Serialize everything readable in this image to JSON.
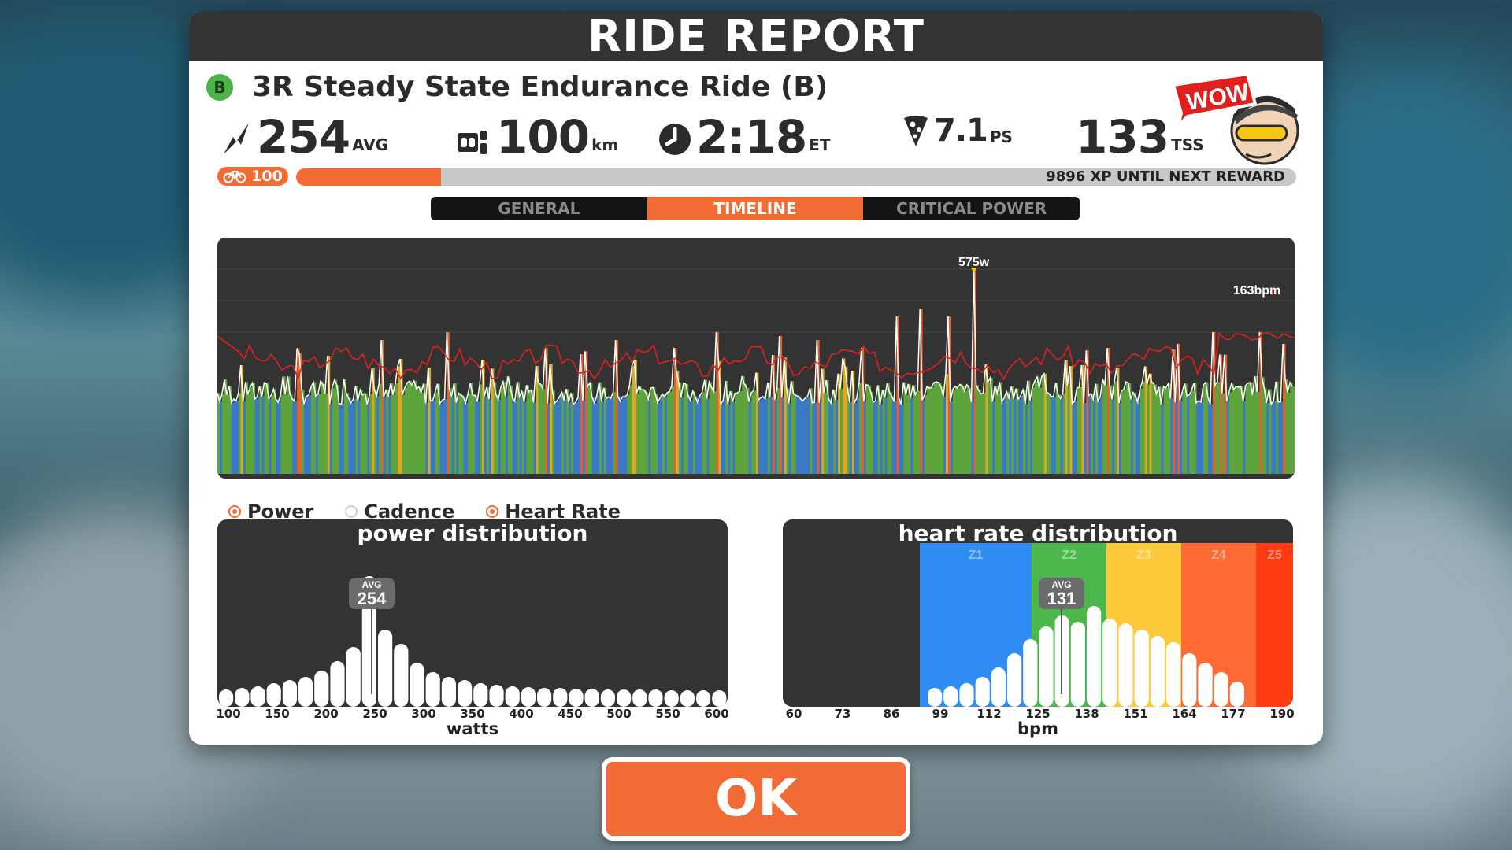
{
  "header": {
    "title": "RIDE REPORT"
  },
  "ride": {
    "category": "B",
    "title": "3R Steady State Endurance Ride (B)"
  },
  "stats": [
    {
      "name": "power",
      "value": "254",
      "unit": "AVG"
    },
    {
      "name": "distance",
      "value": "100",
      "unit": "km"
    },
    {
      "name": "time",
      "value": "2:18",
      "unit": "ET"
    },
    {
      "name": "pizza",
      "value": "7.1",
      "unit": "PS"
    },
    {
      "name": "tss",
      "value": "133",
      "unit": "TSS"
    }
  ],
  "badge": {
    "text": "WOW!"
  },
  "progress": {
    "level": "100",
    "xp_text": "9896 XP UNTIL NEXT REWARD",
    "fill_fraction": 0.145
  },
  "tabs": [
    {
      "label": "GENERAL",
      "active": false
    },
    {
      "label": "TIMELINE",
      "active": true
    },
    {
      "label": "CRITICAL POWER",
      "active": false
    }
  ],
  "timeline": {
    "peak_power_label": "575w",
    "peak_hr_label": "163bpm"
  },
  "legend": [
    {
      "label": "Power",
      "selected": true
    },
    {
      "label": "Cadence",
      "selected": false
    },
    {
      "label": "Heart Rate",
      "selected": true
    }
  ],
  "power_dist": {
    "title": "power distribution",
    "avg_label": "AVG",
    "avg_value": "254",
    "xlabel": "watts",
    "ticks": [
      "100",
      "150",
      "200",
      "250",
      "300",
      "350",
      "400",
      "450",
      "500",
      "550",
      "600"
    ]
  },
  "hr_dist": {
    "title": "heart rate distribution",
    "avg_label": "AVG",
    "avg_value": "131",
    "xlabel": "bpm",
    "ticks": [
      "60",
      "73",
      "86",
      "99",
      "112",
      "125",
      "138",
      "151",
      "164",
      "177",
      "190"
    ],
    "zones": [
      {
        "label": "Z1",
        "color": "#2f8cf2"
      },
      {
        "label": "Z2",
        "color": "#4cb84c"
      },
      {
        "label": "Z3",
        "color": "#fdc93a"
      },
      {
        "label": "Z4",
        "color": "#ff6a35"
      },
      {
        "label": "Z5",
        "color": "#ff3b12"
      }
    ]
  },
  "ok_button": {
    "label": "OK"
  },
  "colors": {
    "accent": "#f26b35",
    "panel": "#333333",
    "hr_line": "#e0201e",
    "power_blue": "#3a78c8",
    "power_green": "#5da43c",
    "power_yellow": "#d7a82a",
    "power_orange": "#e0622e"
  }
}
